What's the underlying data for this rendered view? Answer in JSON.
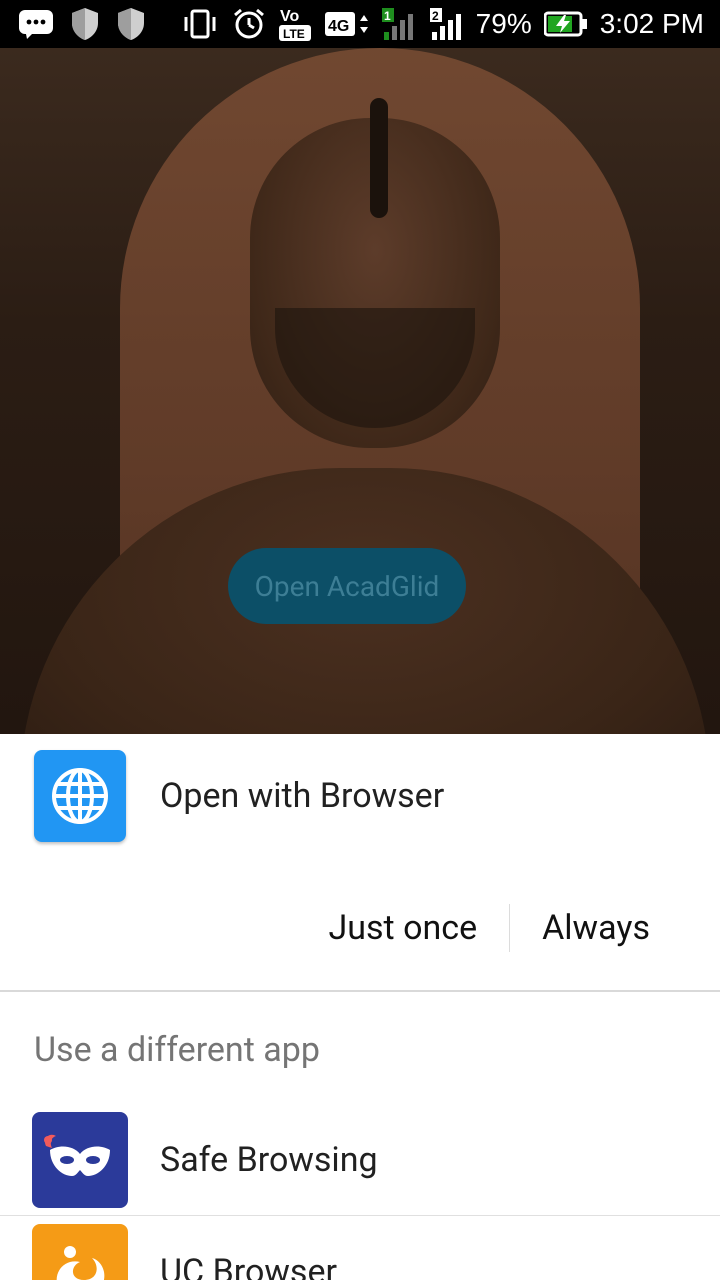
{
  "status_bar": {
    "battery": "79%",
    "time": "3:02 PM",
    "network_label": "4G",
    "volte_top": "Vo",
    "volte_bottom": "LTE",
    "sim1": "1",
    "sim2": "2"
  },
  "background": {
    "button_label": "Open AcadGlid"
  },
  "sheet": {
    "primary_app_label": "Open with Browser",
    "just_once": "Just once",
    "always": "Always",
    "section_title": "Use a different app",
    "apps": [
      {
        "label": "Safe Browsing",
        "icon": "mask-icon",
        "color": "#2b3a9a"
      },
      {
        "label": "UC Browser",
        "icon": "squirrel-icon",
        "color": "#f59b16"
      }
    ]
  },
  "colors": {
    "browser_icon": "#2196f3",
    "sheet_bg": "#ffffff",
    "accent_text": "#111111"
  }
}
